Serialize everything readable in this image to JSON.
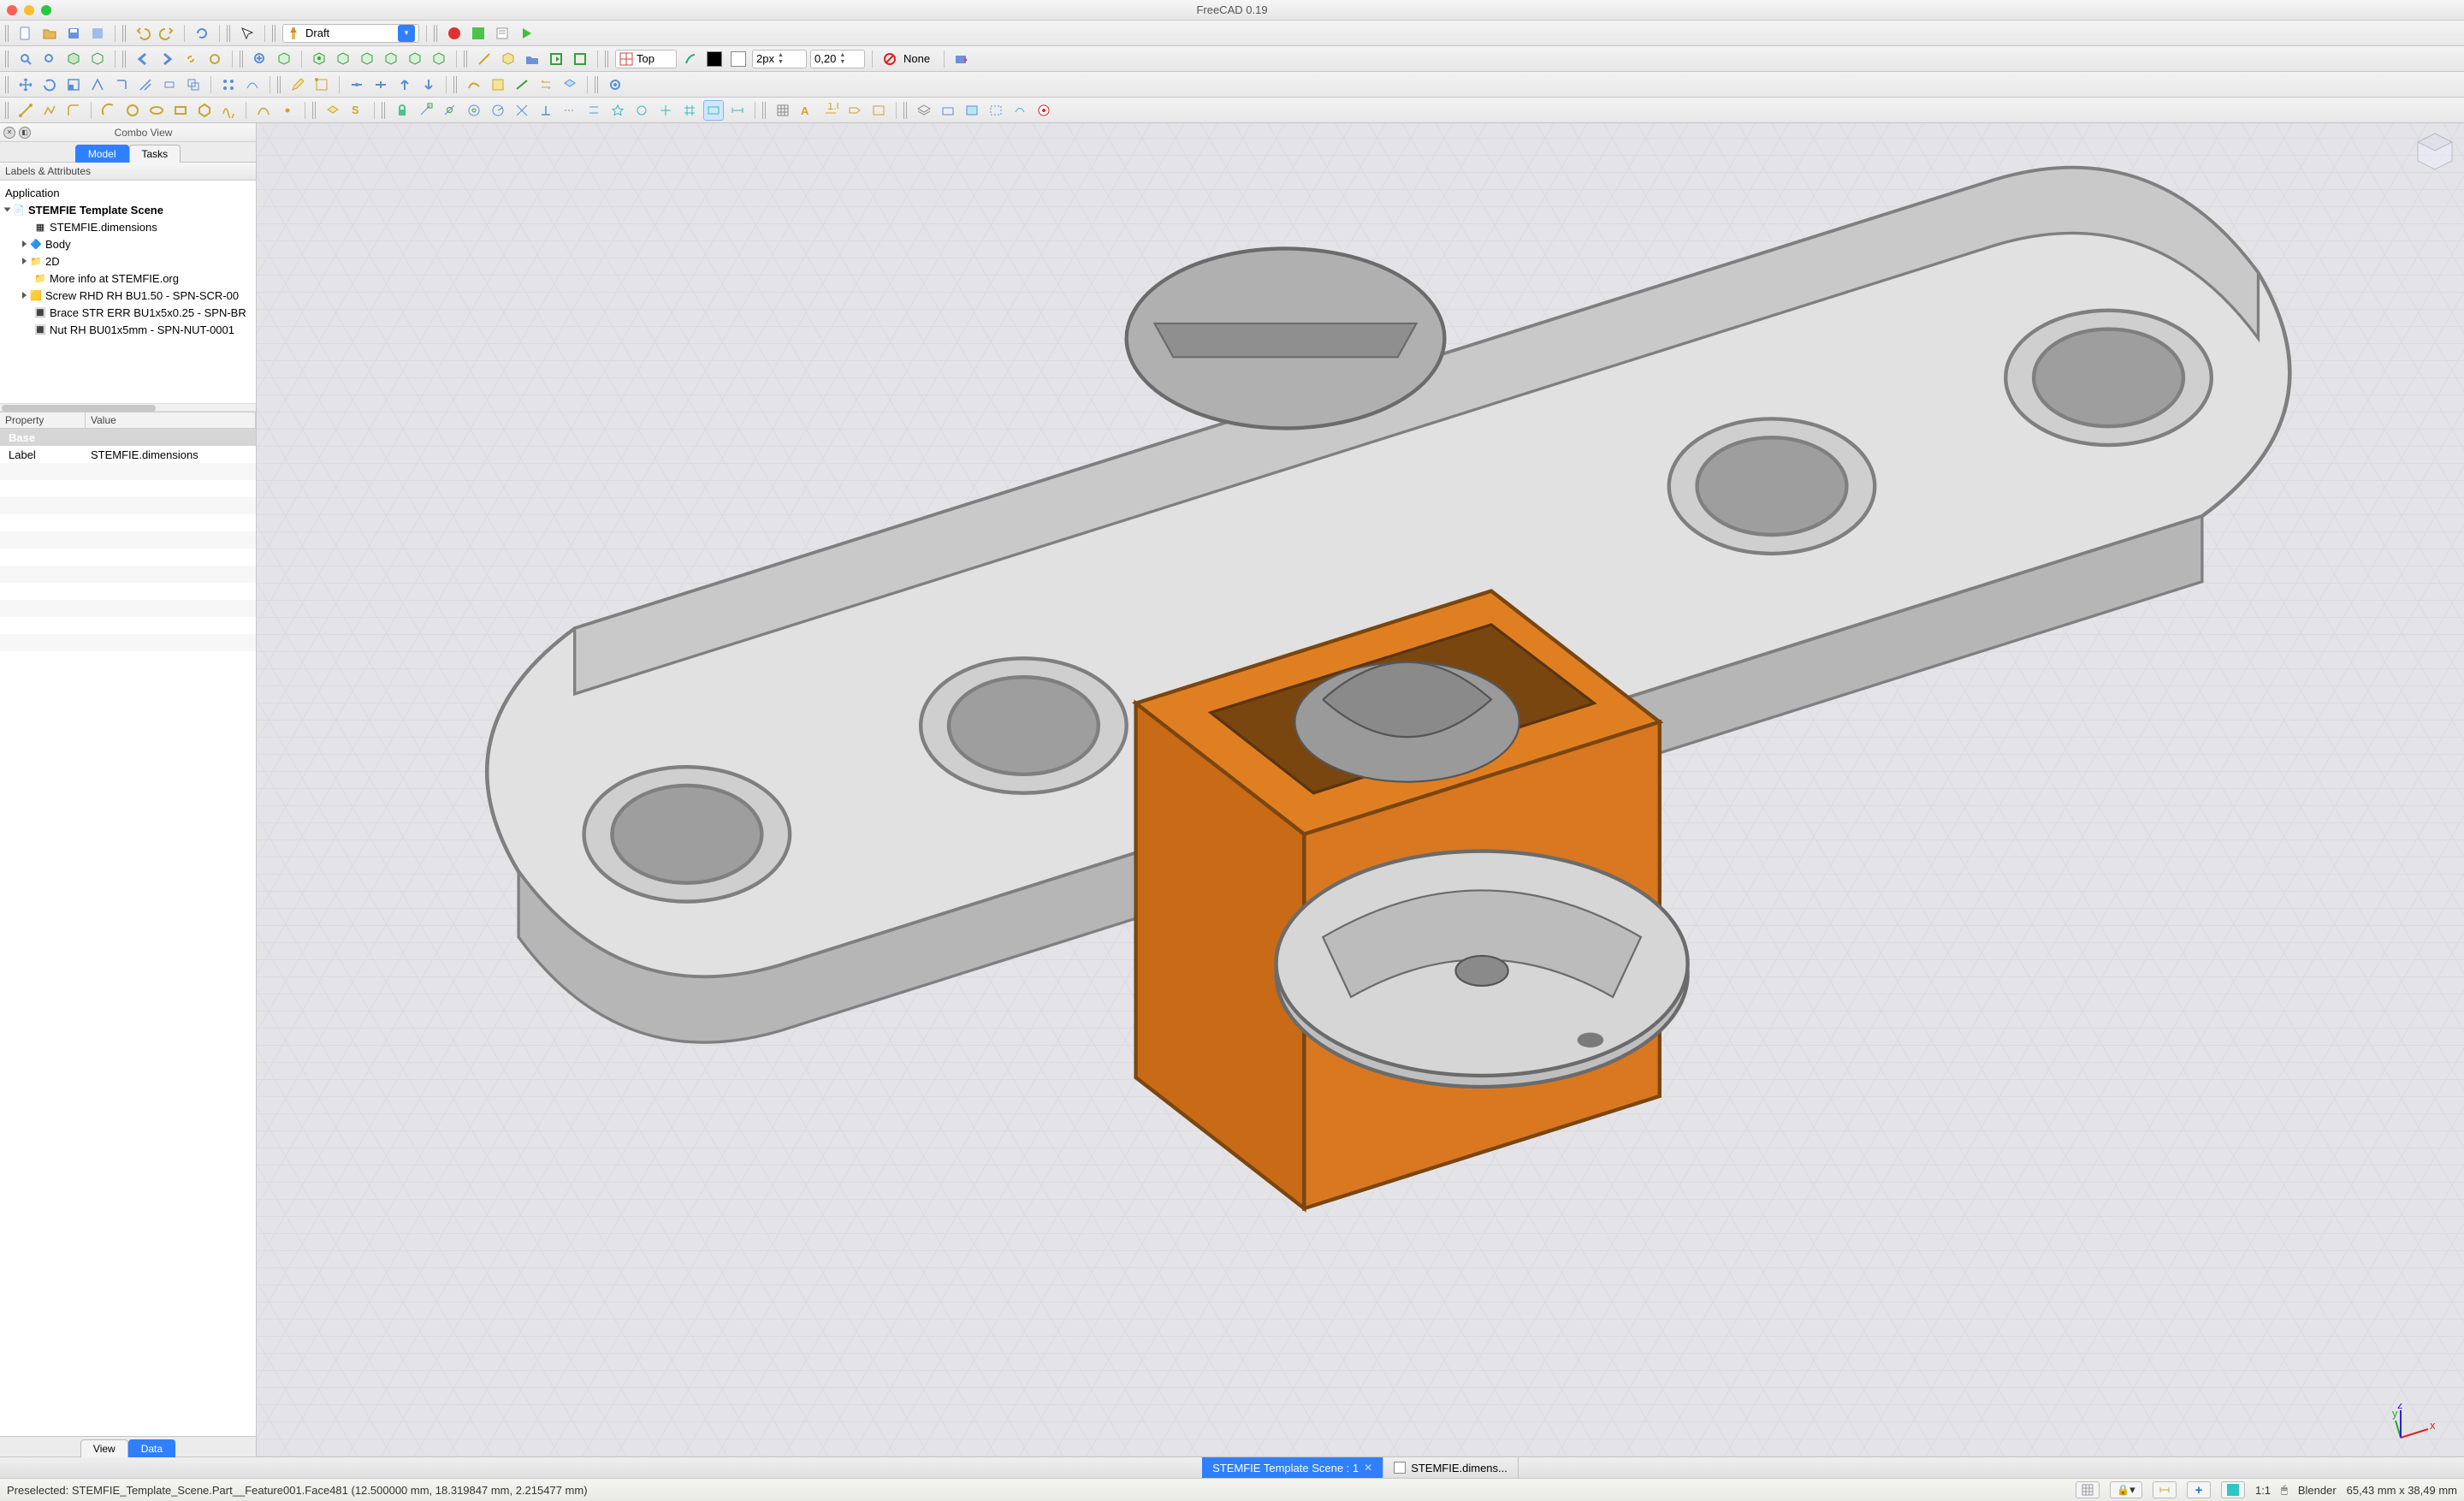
{
  "window_title": "FreeCAD 0.19",
  "workbench_selector": "Draft",
  "toolbar2": {
    "top_label": "Top",
    "linewidth": "2px",
    "precision": "0,20",
    "draw_style": "None"
  },
  "sidebar": {
    "title": "Combo View",
    "tabs": {
      "model": "Model",
      "tasks": "Tasks"
    },
    "labels_header": "Labels & Attributes",
    "tree": {
      "app": "Application",
      "doc": "STEMFIE Template Scene",
      "items": [
        "STEMFIE.dimensions",
        "Body",
        "2D",
        "More info at STEMFIE.org",
        "Screw RHD RH BU1.50 - SPN-SCR-00",
        "Brace STR ERR BU1x5x0.25 - SPN-BR",
        "Nut RH BU01x5mm - SPN-NUT-0001"
      ]
    },
    "prop_headers": {
      "property": "Property",
      "value": "Value"
    },
    "prop_rows": {
      "base": "Base",
      "label_key": "Label",
      "label_val": "STEMFIE.dimensions"
    },
    "bottom_tabs": {
      "view": "View",
      "data": "Data"
    }
  },
  "doctabs": {
    "active": "STEMFIE Template Scene : 1",
    "second": "STEMFIE.dimens..."
  },
  "statusbar": {
    "preselect": "Preselected: STEMFIE_Template_Scene.Part__Feature001.Face481 (12.500000 mm, 18.319847 mm, 2.215477 mm)",
    "zoom": "1:1",
    "blender": "Blender",
    "dims": "65,43 mm x 38,49 mm"
  }
}
